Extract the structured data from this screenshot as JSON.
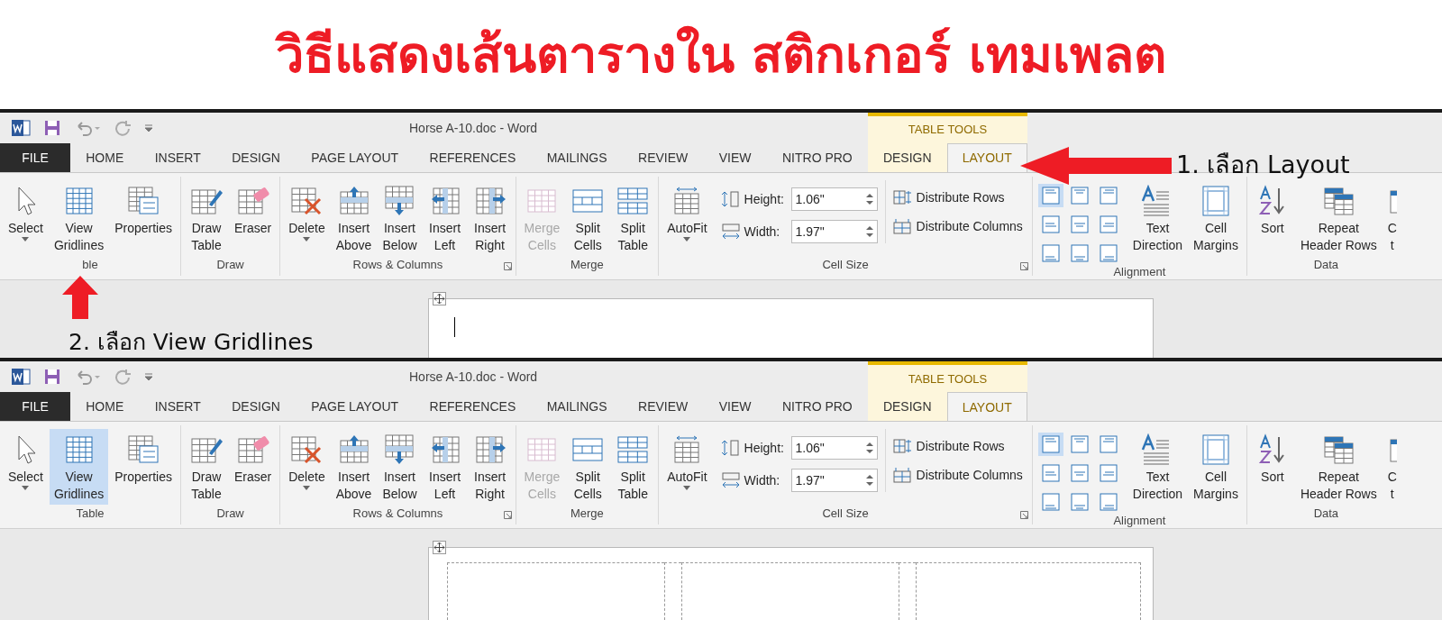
{
  "title": "วิธีแสดงเส้นตารางใน สติกเกอร์ เทมเพลต",
  "screenshots": [
    {
      "window_title": "Horse A-10.doc - Word",
      "context_header": "TABLE TOOLS",
      "tabs": [
        {
          "label": "FILE",
          "kind": "file",
          "selected": false
        },
        {
          "label": "HOME",
          "kind": "normal",
          "selected": false
        },
        {
          "label": "INSERT",
          "kind": "normal",
          "selected": false
        },
        {
          "label": "DESIGN",
          "kind": "normal",
          "selected": false
        },
        {
          "label": "PAGE LAYOUT",
          "kind": "normal",
          "selected": false
        },
        {
          "label": "REFERENCES",
          "kind": "normal",
          "selected": false
        },
        {
          "label": "MAILINGS",
          "kind": "normal",
          "selected": false
        },
        {
          "label": "REVIEW",
          "kind": "normal",
          "selected": false
        },
        {
          "label": "VIEW",
          "kind": "normal",
          "selected": false
        },
        {
          "label": "NITRO PRO",
          "kind": "normal",
          "selected": false
        },
        {
          "label": "DESIGN",
          "kind": "context",
          "selected": false
        },
        {
          "label": "LAYOUT",
          "kind": "context",
          "selected": true
        }
      ],
      "groups": [
        {
          "label": "ble",
          "items": [
            {
              "kind": "button",
              "lines": [
                "Select"
              ],
              "dropdown": true
            },
            {
              "kind": "button",
              "lines": [
                "View",
                "Gridlines"
              ],
              "selected": false
            },
            {
              "kind": "button",
              "lines": [
                "Properties"
              ]
            }
          ]
        },
        {
          "label": "Draw",
          "items": [
            {
              "kind": "button",
              "lines": [
                "Draw",
                "Table"
              ]
            },
            {
              "kind": "button",
              "lines": [
                "Eraser"
              ]
            }
          ]
        },
        {
          "label": "Rows & Columns",
          "launcher": true,
          "items": [
            {
              "kind": "button",
              "lines": [
                "Delete"
              ],
              "dropdown": true
            },
            {
              "kind": "button",
              "lines": [
                "Insert",
                "Above"
              ]
            },
            {
              "kind": "button",
              "lines": [
                "Insert",
                "Below"
              ]
            },
            {
              "kind": "button",
              "lines": [
                "Insert",
                "Left"
              ]
            },
            {
              "kind": "button",
              "lines": [
                "Insert",
                "Right"
              ]
            }
          ]
        },
        {
          "label": "Merge",
          "items": [
            {
              "kind": "button",
              "lines": [
                "Merge",
                "Cells"
              ],
              "disabled": true
            },
            {
              "kind": "button",
              "lines": [
                "Split",
                "Cells"
              ]
            },
            {
              "kind": "button",
              "lines": [
                "Split",
                "Table"
              ]
            }
          ]
        },
        {
          "label": "Cell Size",
          "launcher": true,
          "items": [
            {
              "kind": "button",
              "lines": [
                "AutoFit"
              ],
              "dropdown": true
            },
            {
              "kind": "fields",
              "fields": [
                {
                  "label": "Height:",
                  "value": "1.06\""
                },
                {
                  "label": "Width:",
                  "value": "1.97\""
                }
              ]
            },
            {
              "kind": "distribute",
              "entries": [
                {
                  "label": "Distribute Rows"
                },
                {
                  "label": "Distribute Columns"
                }
              ]
            }
          ]
        },
        {
          "label": "Alignment",
          "items": [
            {
              "kind": "align_grid",
              "cells": [
                {
                  "selected": true
                },
                {
                  "selected": false
                },
                {
                  "selected": false
                },
                {
                  "selected": false
                },
                {
                  "selected": false
                },
                {
                  "selected": false
                },
                {
                  "selected": false
                },
                {
                  "selected": false
                },
                {
                  "selected": false
                }
              ]
            },
            {
              "kind": "button",
              "lines": [
                "Text",
                "Direction"
              ]
            },
            {
              "kind": "button",
              "lines": [
                "Cell",
                "Margins"
              ]
            }
          ]
        },
        {
          "label": "Data",
          "items": [
            {
              "kind": "button",
              "lines": [
                "Sort"
              ]
            },
            {
              "kind": "button",
              "lines": [
                "Repeat",
                "Header Rows"
              ]
            },
            {
              "kind": "partial",
              "lines": [
                "C",
                "t"
              ]
            }
          ]
        }
      ],
      "document": {
        "gridlines": false,
        "cursor": true
      }
    },
    {
      "window_title": "Horse A-10.doc - Word",
      "context_header": "TABLE TOOLS",
      "tabs": [
        {
          "label": "FILE",
          "kind": "file",
          "selected": false
        },
        {
          "label": "HOME",
          "kind": "normal",
          "selected": false
        },
        {
          "label": "INSERT",
          "kind": "normal",
          "selected": false
        },
        {
          "label": "DESIGN",
          "kind": "normal",
          "selected": false
        },
        {
          "label": "PAGE LAYOUT",
          "kind": "normal",
          "selected": false
        },
        {
          "label": "REFERENCES",
          "kind": "normal",
          "selected": false
        },
        {
          "label": "MAILINGS",
          "kind": "normal",
          "selected": false
        },
        {
          "label": "REVIEW",
          "kind": "normal",
          "selected": false
        },
        {
          "label": "VIEW",
          "kind": "normal",
          "selected": false
        },
        {
          "label": "NITRO PRO",
          "kind": "normal",
          "selected": false
        },
        {
          "label": "DESIGN",
          "kind": "context",
          "selected": false
        },
        {
          "label": "LAYOUT",
          "kind": "context",
          "selected": true
        }
      ],
      "groups": [
        {
          "label": "Table",
          "items": [
            {
              "kind": "button",
              "lines": [
                "Select"
              ],
              "dropdown": true
            },
            {
              "kind": "button",
              "lines": [
                "View",
                "Gridlines"
              ],
              "selected": true
            },
            {
              "kind": "button",
              "lines": [
                "Properties"
              ]
            }
          ]
        },
        {
          "label": "Draw",
          "items": [
            {
              "kind": "button",
              "lines": [
                "Draw",
                "Table"
              ]
            },
            {
              "kind": "button",
              "lines": [
                "Eraser"
              ]
            }
          ]
        },
        {
          "label": "Rows & Columns",
          "launcher": true,
          "items": [
            {
              "kind": "button",
              "lines": [
                "Delete"
              ],
              "dropdown": true
            },
            {
              "kind": "button",
              "lines": [
                "Insert",
                "Above"
              ]
            },
            {
              "kind": "button",
              "lines": [
                "Insert",
                "Below"
              ]
            },
            {
              "kind": "button",
              "lines": [
                "Insert",
                "Left"
              ]
            },
            {
              "kind": "button",
              "lines": [
                "Insert",
                "Right"
              ]
            }
          ]
        },
        {
          "label": "Merge",
          "items": [
            {
              "kind": "button",
              "lines": [
                "Merge",
                "Cells"
              ],
              "disabled": true
            },
            {
              "kind": "button",
              "lines": [
                "Split",
                "Cells"
              ]
            },
            {
              "kind": "button",
              "lines": [
                "Split",
                "Table"
              ]
            }
          ]
        },
        {
          "label": "Cell Size",
          "launcher": true,
          "items": [
            {
              "kind": "button",
              "lines": [
                "AutoFit"
              ],
              "dropdown": true
            },
            {
              "kind": "fields",
              "fields": [
                {
                  "label": "Height:",
                  "value": "1.06\""
                },
                {
                  "label": "Width:",
                  "value": "1.97\""
                }
              ]
            },
            {
              "kind": "distribute",
              "entries": [
                {
                  "label": "Distribute Rows"
                },
                {
                  "label": "Distribute Columns"
                }
              ]
            }
          ]
        },
        {
          "label": "Alignment",
          "items": [
            {
              "kind": "align_grid",
              "cells": [
                {
                  "selected": true
                },
                {
                  "selected": false
                },
                {
                  "selected": false
                },
                {
                  "selected": false
                },
                {
                  "selected": false
                },
                {
                  "selected": false
                },
                {
                  "selected": false
                },
                {
                  "selected": false
                },
                {
                  "selected": false
                }
              ]
            },
            {
              "kind": "button",
              "lines": [
                "Text",
                "Direction"
              ]
            },
            {
              "kind": "button",
              "lines": [
                "Cell",
                "Margins"
              ]
            }
          ]
        },
        {
          "label": "Data",
          "items": [
            {
              "kind": "button",
              "lines": [
                "Sort"
              ]
            },
            {
              "kind": "button",
              "lines": [
                "Repeat",
                "Header Rows"
              ]
            },
            {
              "kind": "partial",
              "lines": [
                "C",
                "t"
              ]
            }
          ]
        }
      ],
      "document": {
        "gridlines": true,
        "cursor": false
      }
    }
  ],
  "annotations": [
    {
      "text": "1. เลือก Layout"
    },
    {
      "text": "2. เลือก View Gridlines"
    }
  ]
}
